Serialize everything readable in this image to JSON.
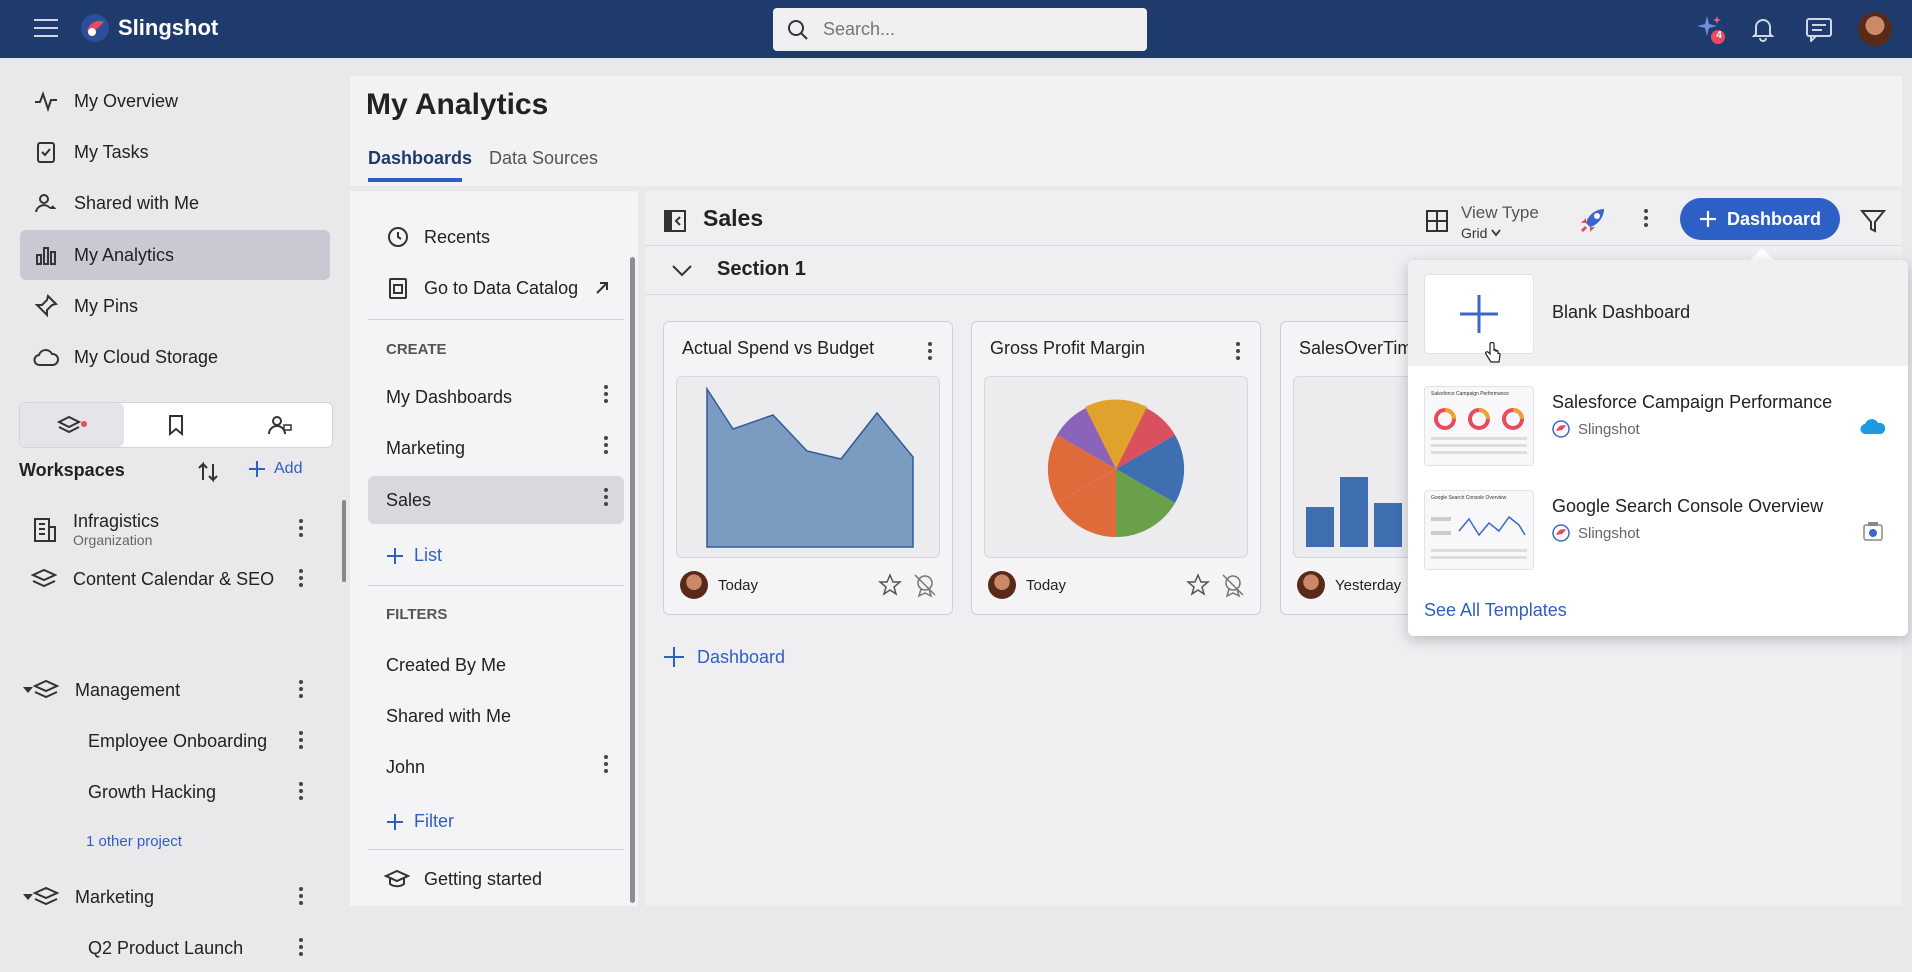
{
  "app": {
    "name": "Slingshot"
  },
  "header": {
    "search_placeholder": "Search...",
    "notif_badge": "4"
  },
  "colors": {
    "brand": "#1f3b6e",
    "accent": "#2e5fc4",
    "active_nav": "#c8c9d2",
    "chart_fill": "#7b9bc0"
  },
  "nav": {
    "items": [
      {
        "label": "My Overview",
        "icon": "activity-icon"
      },
      {
        "label": "My Tasks",
        "icon": "task-icon"
      },
      {
        "label": "Shared with Me",
        "icon": "shared-user-icon"
      },
      {
        "label": "My Analytics",
        "icon": "bar-chart-icon",
        "active": true
      },
      {
        "label": "My Pins",
        "icon": "pin-icon"
      },
      {
        "label": "My Cloud Storage",
        "icon": "cloud-icon"
      }
    ]
  },
  "workspaces": {
    "title": "Workspaces",
    "add_label": "Add",
    "items": [
      {
        "name": "Infragistics",
        "subtitle": "Organization"
      },
      {
        "name": "Content Calendar & SEO"
      },
      {
        "name": "Management"
      },
      {
        "name": "Employee Onboarding"
      },
      {
        "name": "Growth Hacking"
      },
      {
        "name": "Marketing"
      },
      {
        "name": "Q2 Product Launch"
      }
    ],
    "other_projects": "1 other project"
  },
  "main": {
    "title": "My Analytics",
    "tabs": [
      {
        "label": "Dashboards",
        "active": true
      },
      {
        "label": "Data Sources"
      }
    ]
  },
  "left_panel": {
    "recents": "Recents",
    "catalog": "Go to Data Catalog",
    "create_label": "CREATE",
    "lists": [
      "My Dashboards",
      "Marketing",
      "Sales"
    ],
    "add_list": "List",
    "filters_label": "FILTERS",
    "filters": [
      "Created By Me",
      "Shared with Me",
      "John"
    ],
    "add_filter": "Filter",
    "getting_started": "Getting started"
  },
  "content": {
    "title": "Sales",
    "view_type_label": "View Type",
    "view_type_value": "Grid",
    "add_dashboard_button": "Dashboard",
    "section_title": "Section 1",
    "add_dashboard_link": "Dashboard",
    "cards": [
      {
        "title": "Actual Spend vs Budget",
        "date": "Today"
      },
      {
        "title": "Gross Profit Margin",
        "date": "Today"
      },
      {
        "title": "SalesOverTim",
        "date": "Yesterday"
      }
    ]
  },
  "dropdown": {
    "blank": "Blank Dashboard",
    "templates": [
      {
        "name": "Salesforce Campaign Performance",
        "source": "Slingshot",
        "thumb_title": "Salesforce Campaign Performance"
      },
      {
        "name": "Google Search Console Overview",
        "source": "Slingshot",
        "thumb_title": "Google Search Console Overview"
      }
    ],
    "see_all": "See All Templates"
  }
}
